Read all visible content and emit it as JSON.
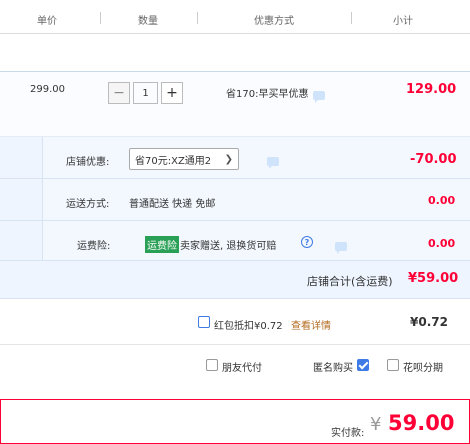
{
  "header": {
    "unit_price": "单价",
    "quantity": "数量",
    "discount": "优惠方式",
    "subtotal": "小计"
  },
  "product": {
    "price": "299.00",
    "quantity": "1",
    "minus": "−",
    "plus": "+",
    "promo": "省170:早买早优惠",
    "subtotal": "129.00"
  },
  "shop": {
    "coupon_label": "店铺优惠:",
    "coupon_value": "省70元:XZ通用2",
    "coupon_amount": "-70.00",
    "shipping_label": "运送方式:",
    "shipping_value": "普通配送 快递 免邮",
    "shipping_amount": "0.00",
    "insurance_label": "运费险:",
    "insurance_tag": "运费险",
    "insurance_text": "卖家赠送, 退换货可赔",
    "insurance_amount": "0.00",
    "total_label": "店铺合计(含运费)",
    "total_value": "¥59.00"
  },
  "redpacket": {
    "label": "红包抵扣¥0.72",
    "link": "查看详情",
    "amount": "¥0.72"
  },
  "options": {
    "friend_pay": "朋友代付",
    "anonymous": "匿名购买",
    "huabei": "花呗分期"
  },
  "payment": {
    "label": "实付款:",
    "currency": "¥",
    "amount": "59.00"
  },
  "colors": {
    "accent_red": "#ff0036",
    "blue": "#3e7be6",
    "green_tag": "#2aa056"
  }
}
